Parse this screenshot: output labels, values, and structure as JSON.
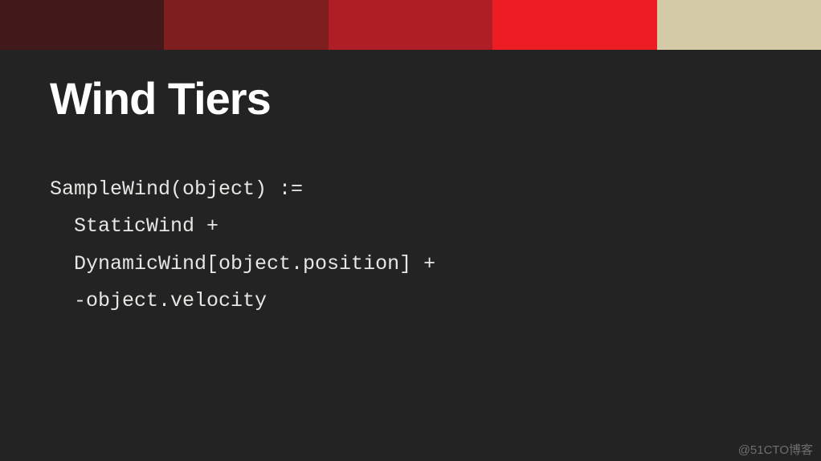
{
  "colorBar": {
    "colors": [
      "#42181a",
      "#7f1e1f",
      "#af1e24",
      "#ed1d24",
      "#d3caa7"
    ]
  },
  "slide": {
    "title": "Wind Tiers",
    "code": "SampleWind(object) :=\n  StaticWind +\n  DynamicWind[object.position] +\n  -object.velocity"
  },
  "watermark": "@51CTO博客"
}
